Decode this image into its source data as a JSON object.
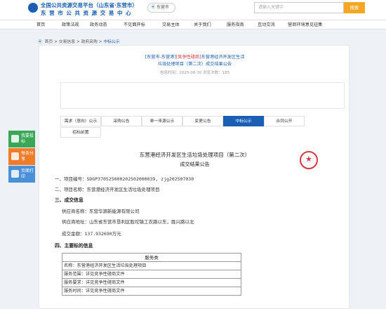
{
  "header": {
    "title_line1": "全国公共资源交易平台（山东省·东营市）",
    "title_line2": "东 营 市 公 共 资 源 交 易 中 心",
    "location": "东营市",
    "search_placeholder": "请输入关键字",
    "search_button": "搜索"
  },
  "nav": [
    "首页",
    "政策法规",
    "政务动态",
    "不见面开标",
    "交易主体",
    "关于我们",
    "服务指南",
    "互动交流",
    "营商环境意见征集"
  ],
  "breadcrumb": {
    "items": [
      "首页",
      "交易信息",
      "政府采购"
    ],
    "current": "中标公示"
  },
  "notice_header": {
    "tag_left": "[东营市-东营港]",
    "tag_red": "[竞争性磋商]",
    "title_rest": "东营港经济开发区生活",
    "title_line2": "垃圾处理项目（第二次）成交结果公告",
    "meta": "信息时间：2025-06-30   浏览次数：185"
  },
  "tabs": [
    {
      "label": "需求（意向）公示",
      "active": false
    },
    {
      "label": "采购公告",
      "active": false
    },
    {
      "label": "单一来源公示",
      "active": false
    },
    {
      "label": "变更公告",
      "active": false
    },
    {
      "label": "中标公示",
      "active": true
    },
    {
      "label": "合同公开",
      "active": false
    },
    {
      "label": "招标前置",
      "active": false
    }
  ],
  "notice": {
    "title": "东营港经济开发区生活垃圾处理项目（第二次）",
    "subtitle": "成交结果公告",
    "project_no": "一、项目编号：SDGP370525000202502000039, zjg202507030",
    "project_name": "二、项目名称：东营港经济开发区生活垃圾处理项目",
    "result_heading": "三、成交信息",
    "supplier_name": "供应商名称：东营华源新能源有限公司",
    "supplier_addr": "供应商地址：山东省东营市垦利区胜坨镇工农路以东，胜兴路以北",
    "amount": "成交金额：137.932690万元",
    "subject_heading": "四、主要标的信息"
  },
  "service_table": {
    "header": "服务类",
    "rows": [
      "名称：东营港经济开发区生活垃圾处理项目",
      "服务范围：详见竞争性磋商文件",
      "服务要求：详见竞争性磋商文件",
      "服务时间：详见竞争性磋商文件"
    ]
  },
  "side_panel": [
    {
      "label": "我要投标",
      "color": "#3aa757",
      "icon": "document-icon"
    },
    {
      "label": "每条分享",
      "color": "#f07c2a",
      "icon": "share-icon"
    },
    {
      "label": "页面打印",
      "color": "#4a90d9",
      "icon": "print-icon"
    }
  ]
}
